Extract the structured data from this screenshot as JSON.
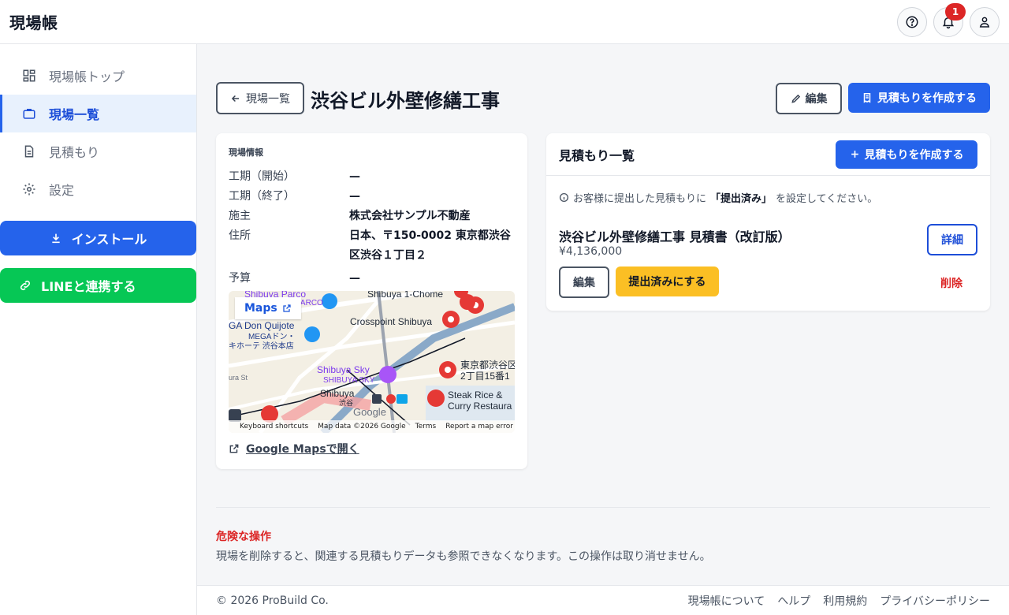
{
  "app": {
    "title": "現場帳"
  },
  "header": {
    "notification_count": "1"
  },
  "sidebar": {
    "items": [
      {
        "label": "現場帳トップ",
        "icon": "dashboard-icon"
      },
      {
        "label": "現場一覧",
        "icon": "briefcase-icon"
      },
      {
        "label": "見積もり",
        "icon": "document-icon"
      },
      {
        "label": "設定",
        "icon": "gear-icon"
      }
    ],
    "install_label": "インストール",
    "line_label": "LINEと連携する"
  },
  "page": {
    "back_label": "現場一覧",
    "title": "渋谷ビル外壁修繕工事",
    "edit_label": "編集",
    "create_estimate_label": "見積もりを作成する"
  },
  "site_info": {
    "section_label": "現場情報",
    "rows": [
      {
        "key": "工期（開始）",
        "value": "—"
      },
      {
        "key": "工期（終了）",
        "value": "—"
      },
      {
        "key": "施主",
        "value": "株式会社サンプル不動産"
      },
      {
        "key": "住所",
        "value": "日本、〒150-0002 東京都渋谷区渋谷１丁目２"
      },
      {
        "key": "予算",
        "value": "—"
      }
    ],
    "map": {
      "chip_label": "Maps",
      "labels": {
        "parco": "Shibuya Parco",
        "parco_sub": "PARCO",
        "don": "GA Don Quijote",
        "don_sub": "MEGAドン・",
        "don_sub2": "キホーテ 渋谷本店",
        "crosspoint": "Crosspoint Shibuya",
        "chome": "Shibuya 1-Chome",
        "sky": "Shibuya Sky",
        "sky_sub": "SHIBUYA SKY",
        "shibuya": "Shibuya",
        "shibuya_sub": "渋谷",
        "address1": "東京都渋谷区",
        "address2": "2丁目15番1",
        "steak1": "Steak Rice &",
        "steak2": "Curry Restaura",
        "google": "Google",
        "dura": "ura St"
      },
      "attribution": [
        "Keyboard shortcuts",
        "Map data ©2026 Google",
        "Terms",
        "Report a map error"
      ]
    },
    "gmaps_link": "Google Mapsで開く"
  },
  "estimates": {
    "title": "見積もり一覧",
    "create_label": "見積もりを作成する",
    "hint_prefix": "お客様に提出した見積もりに",
    "hint_bold": "「提出済み」",
    "hint_suffix": "を設定してください。",
    "item": {
      "title": "渋谷ビル外壁修繕工事 見積書（改訂版）",
      "amount": "¥4,136,000",
      "detail_label": "詳細",
      "edit_label": "編集",
      "submit_label": "提出済みにする",
      "delete_label": "削除"
    }
  },
  "danger": {
    "title": "危険な操作",
    "description": "現場を削除すると、関連する見積もりデータも参照できなくなります。この操作は取り消せません。"
  },
  "footer": {
    "copyright": "© 2026 ProBuild Co.",
    "links": [
      "現場帳について",
      "ヘルプ",
      "利用規約",
      "プライバシーポリシー"
    ]
  }
}
